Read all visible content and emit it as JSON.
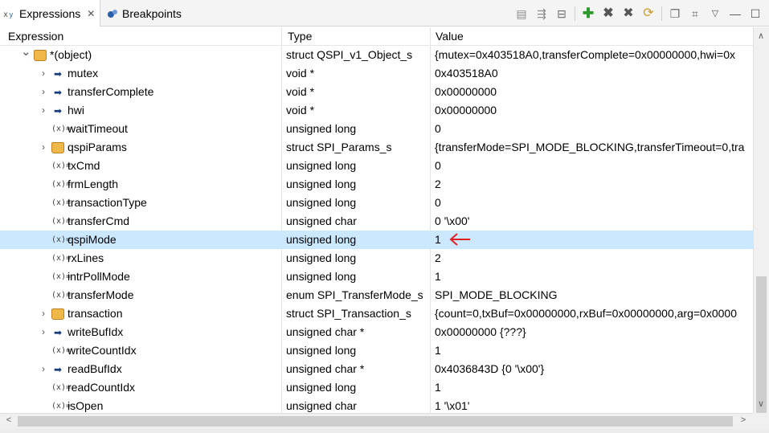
{
  "tabs": [
    {
      "label": "Expressions",
      "icon": "expressions-icon",
      "active": true
    },
    {
      "label": "Breakpoints",
      "icon": "breakpoints-icon",
      "active": false
    }
  ],
  "columns": {
    "expression": "Expression",
    "type": "Type",
    "value": "Value"
  },
  "rows": [
    {
      "name": "*(object)",
      "type": "struct QSPI_v1_Object_s",
      "value": "{mutex=0x403518A0,transferComplete=0x00000000,hwi=0x",
      "icon": "struct-icon",
      "expander": "expanded"
    },
    {
      "name": "mutex",
      "type": "void *",
      "value": "0x403518A0",
      "icon": "pointer-icon",
      "expander": "collapsed"
    },
    {
      "name": "transferComplete",
      "type": "void *",
      "value": "0x00000000",
      "icon": "pointer-icon",
      "expander": "collapsed"
    },
    {
      "name": "hwi",
      "type": "void *",
      "value": "0x00000000",
      "icon": "pointer-icon",
      "expander": "collapsed"
    },
    {
      "name": "waitTimeout",
      "type": "unsigned long",
      "value": "0",
      "icon": "variable-icon",
      "expander": "none"
    },
    {
      "name": "qspiParams",
      "type": "struct SPI_Params_s",
      "value": "{transferMode=SPI_MODE_BLOCKING,transferTimeout=0,tra",
      "icon": "struct-icon",
      "expander": "collapsed"
    },
    {
      "name": "txCmd",
      "type": "unsigned long",
      "value": "0",
      "icon": "variable-icon",
      "expander": "none"
    },
    {
      "name": "frmLength",
      "type": "unsigned long",
      "value": "2",
      "icon": "variable-icon",
      "expander": "none"
    },
    {
      "name": "transactionType",
      "type": "unsigned long",
      "value": "0",
      "icon": "variable-icon",
      "expander": "none"
    },
    {
      "name": "transferCmd",
      "type": "unsigned char",
      "value": "0 '\\x00'",
      "icon": "variable-icon",
      "expander": "none"
    },
    {
      "name": "qspiMode",
      "type": "unsigned long",
      "value": "1",
      "icon": "variable-icon",
      "expander": "none",
      "selected": true
    },
    {
      "name": "rxLines",
      "type": "unsigned long",
      "value": "2",
      "icon": "variable-icon",
      "expander": "none"
    },
    {
      "name": "intrPollMode",
      "type": "unsigned long",
      "value": "1",
      "icon": "variable-icon",
      "expander": "none"
    },
    {
      "name": "transferMode",
      "type": "enum SPI_TransferMode_s",
      "value": "SPI_MODE_BLOCKING",
      "icon": "variable-icon",
      "expander": "none"
    },
    {
      "name": "transaction",
      "type": "struct SPI_Transaction_s",
      "value": "{count=0,txBuf=0x00000000,rxBuf=0x00000000,arg=0x0000",
      "icon": "struct-icon",
      "expander": "collapsed"
    },
    {
      "name": "writeBufIdx",
      "type": "unsigned char *",
      "value": "0x00000000 {???}",
      "icon": "pointer-icon",
      "expander": "collapsed"
    },
    {
      "name": "writeCountIdx",
      "type": "unsigned long",
      "value": "1",
      "icon": "variable-icon",
      "expander": "none"
    },
    {
      "name": "readBufIdx",
      "type": "unsigned char *",
      "value": "0x4036843D {0 '\\x00'}",
      "icon": "pointer-icon",
      "expander": "collapsed"
    },
    {
      "name": "readCountIdx",
      "type": "unsigned long",
      "value": "1",
      "icon": "variable-icon",
      "expander": "none"
    },
    {
      "name": "isOpen",
      "type": "unsigned char",
      "value": "1 '\\x01'",
      "icon": "variable-icon",
      "expander": "none"
    }
  ],
  "colors": {
    "selection": "#cce8ff",
    "annotation_arrow": "#e02020"
  }
}
